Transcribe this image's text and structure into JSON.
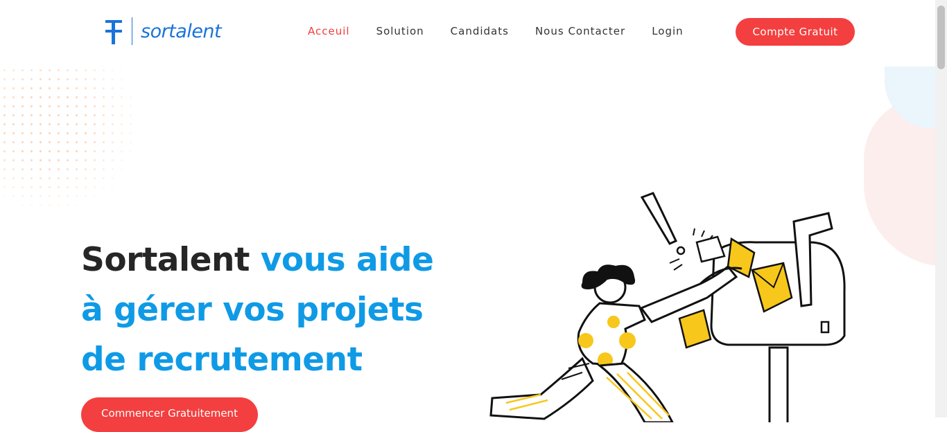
{
  "brand": {
    "name": "sortalent",
    "mark_icon": "sortalent-logo-icon"
  },
  "nav": {
    "items": [
      {
        "label": "Acceuil",
        "active": true
      },
      {
        "label": "Solution",
        "active": false
      },
      {
        "label": "Candidats",
        "active": false
      },
      {
        "label": "Nous Contacter",
        "active": false
      },
      {
        "label": "Login",
        "active": false
      }
    ],
    "cta_label": "Compte Gratuit"
  },
  "hero": {
    "title_dark": "Sortalent ",
    "title_blue_1": "vous aide",
    "title_blue_2": "à gérer vos projets",
    "title_blue_3": "de recrutement",
    "cta_label": "Commencer Gratuitement",
    "illustration_icon": "person-pushing-mailbox-illustration"
  },
  "colors": {
    "accent_red": "#f33f3f",
    "brand_blue": "#1a73d9",
    "title_blue": "#0f9ae6",
    "mail_yellow": "#f7c71b"
  }
}
